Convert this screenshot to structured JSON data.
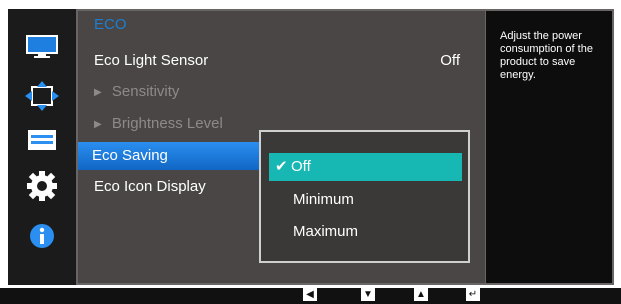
{
  "menu": {
    "title": "ECO",
    "items": [
      {
        "label": "Eco Light Sensor",
        "value": "Off"
      },
      {
        "label": "Sensitivity"
      },
      {
        "label": "Brightness Level"
      },
      {
        "label": "Eco Saving"
      },
      {
        "label": "Eco Icon Display"
      }
    ]
  },
  "submenu": {
    "options": [
      "Off",
      "Minimum",
      "Maximum"
    ],
    "selected": "Off"
  },
  "help": {
    "text": "Adjust the power consumption of the product to save energy."
  },
  "sidebar": {
    "icons": [
      "picture-icon",
      "position-icon",
      "system-icon",
      "settings-gear-icon",
      "information-icon"
    ]
  },
  "buttons": [
    "left-arrow-icon",
    "down-arrow-icon",
    "up-arrow-icon",
    "enter-icon"
  ],
  "colors": {
    "title_accent": "#1b7fd3",
    "selected_item": "#1a7ae0",
    "selected_option": "#17b8b3",
    "panel": "#4a4646"
  }
}
